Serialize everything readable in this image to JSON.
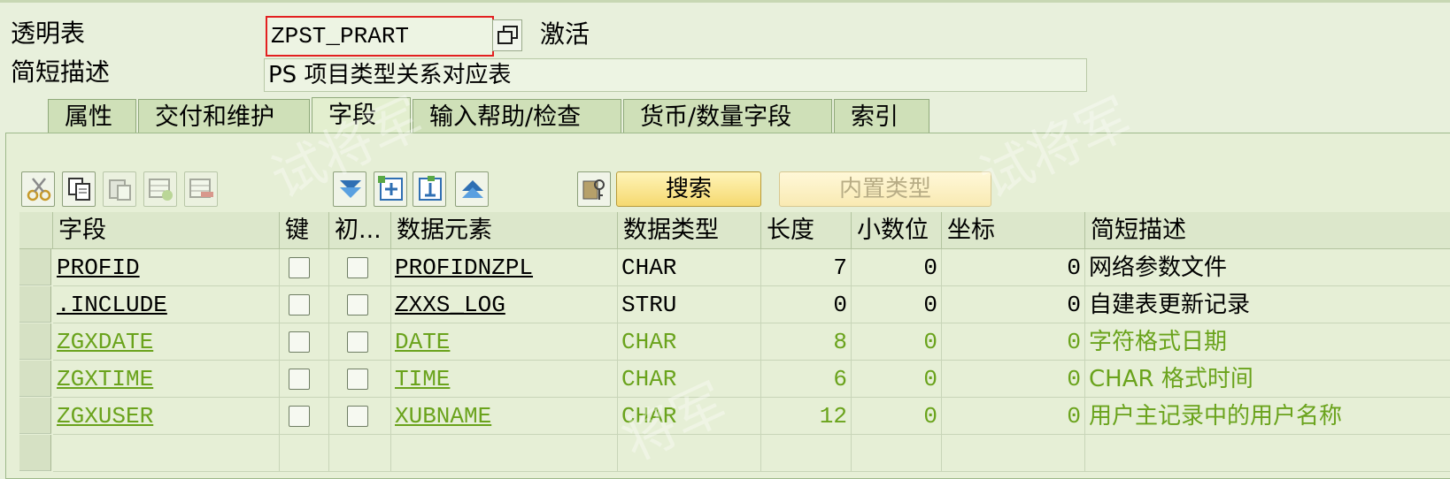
{
  "header": {
    "table_label": "透明表",
    "table_value": "ZPST_PRART",
    "status": "激活",
    "desc_label": "简短描述",
    "desc_value": "PS 项目类型关系对应表"
  },
  "tabs": [
    {
      "label": "属性",
      "active": false
    },
    {
      "label": "交付和维护",
      "active": false
    },
    {
      "label": "字段",
      "active": true
    },
    {
      "label": "输入帮助/检查",
      "active": false
    },
    {
      "label": "货币/数量字段",
      "active": false
    },
    {
      "label": "索引",
      "active": false
    }
  ],
  "toolbar": {
    "icons": [
      "cut-icon",
      "copy-icon",
      "paste-icon",
      "insert-row-icon",
      "delete-row-icon",
      "expand-down-icon",
      "new-field-icon",
      "append-field-icon",
      "collapse-up-icon",
      "key-help-icon"
    ],
    "search_label": "搜索",
    "builtin_type_label": "内置类型"
  },
  "grid": {
    "columns": [
      "字段",
      "键",
      "初...",
      "数据元素",
      "数据类型",
      "长度",
      "小数位",
      "坐标",
      "简短描述"
    ],
    "rows": [
      {
        "field": "PROFID",
        "key": false,
        "init": false,
        "element": "PROFIDNZPL",
        "type": "CHAR",
        "length": "7",
        "decimals": "0",
        "coord": "0",
        "desc": "网络参数文件",
        "color": "black"
      },
      {
        "field": ".INCLUDE",
        "key": false,
        "init": false,
        "element": "ZXXS_LOG",
        "type": "STRU",
        "length": "0",
        "decimals": "0",
        "coord": "0",
        "desc": "自建表更新记录",
        "color": "black"
      },
      {
        "field": "ZGXDATE",
        "key": false,
        "init": false,
        "element": "DATE",
        "type": "CHAR",
        "length": "8",
        "decimals": "0",
        "coord": "0",
        "desc": "字符格式日期",
        "color": "green"
      },
      {
        "field": "ZGXTIME",
        "key": false,
        "init": false,
        "element": "TIME",
        "type": "CHAR",
        "length": "6",
        "decimals": "0",
        "coord": "0",
        "desc": "CHAR 格式时间",
        "color": "green"
      },
      {
        "field": "ZGXUSER",
        "key": false,
        "init": false,
        "element": "XUBNAME",
        "type": "CHAR",
        "length": "12",
        "decimals": "0",
        "coord": "0",
        "desc": "用户主记录中的用户名称",
        "color": "green"
      }
    ]
  },
  "colors": {
    "accent_green": "#6aa31c",
    "background": "#e8f0dc",
    "required_border": "#e32020"
  }
}
